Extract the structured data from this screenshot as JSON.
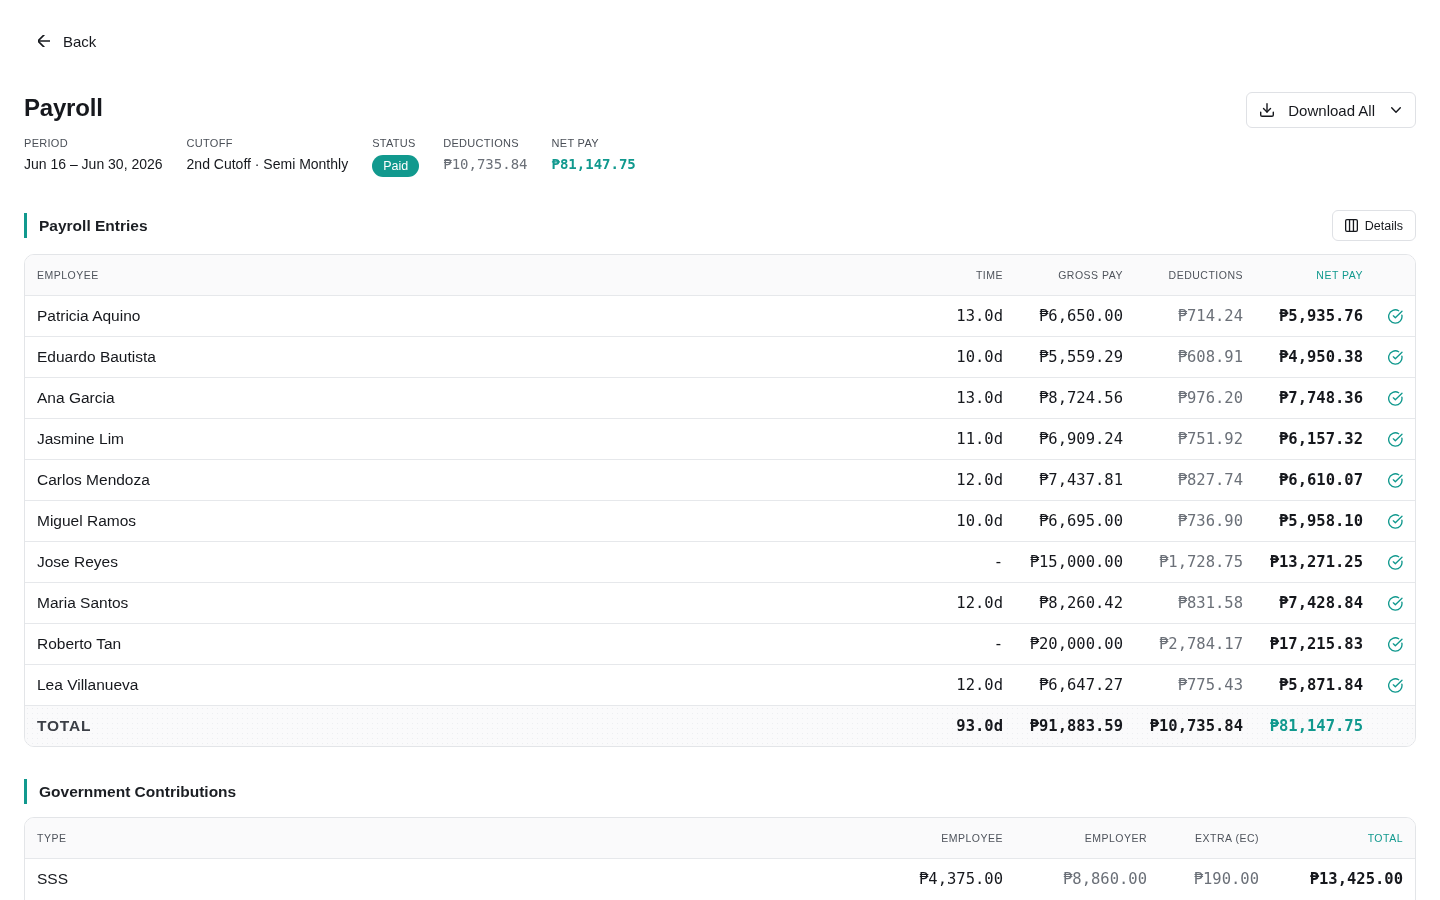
{
  "back_link": {
    "label": "Back"
  },
  "page": {
    "title": "Payroll",
    "download_button": "Download All"
  },
  "summary": [
    {
      "label": "PERIOD",
      "value": "Jun 16 – Jun 30, 2026",
      "kind": "text"
    },
    {
      "label": "CUTOFF",
      "value": "2nd Cutoff · Semi Monthly",
      "kind": "text"
    },
    {
      "label": "STATUS",
      "value": "Paid",
      "kind": "badge"
    },
    {
      "label": "DEDUCTIONS",
      "value": "₱10,735.84",
      "kind": "amount"
    },
    {
      "label": "NET PAY",
      "value": "₱81,147.75",
      "kind": "amount_accent"
    }
  ],
  "entries": {
    "title": "Payroll Entries",
    "details_button": "Details",
    "columns": [
      {
        "label": "EMPLOYEE",
        "highlighted": false
      },
      {
        "label": "TIME",
        "highlighted": false
      },
      {
        "label": "GROSS PAY",
        "highlighted": false
      },
      {
        "label": "DEDUCTIONS",
        "highlighted": false
      },
      {
        "label": "NET PAY",
        "highlighted": true
      }
    ],
    "rows": [
      {
        "employee": "Patricia Aquino",
        "time": "13.0d",
        "gross_pay": "₱6,650.00",
        "deductions": "₱714.24",
        "net_pay": "₱5,935.76",
        "paid": true
      },
      {
        "employee": "Eduardo Bautista",
        "time": "10.0d",
        "gross_pay": "₱5,559.29",
        "deductions": "₱608.91",
        "net_pay": "₱4,950.38",
        "paid": true
      },
      {
        "employee": "Ana Garcia",
        "time": "13.0d",
        "gross_pay": "₱8,724.56",
        "deductions": "₱976.20",
        "net_pay": "₱7,748.36",
        "paid": true
      },
      {
        "employee": "Jasmine Lim",
        "time": "11.0d",
        "gross_pay": "₱6,909.24",
        "deductions": "₱751.92",
        "net_pay": "₱6,157.32",
        "paid": true
      },
      {
        "employee": "Carlos Mendoza",
        "time": "12.0d",
        "gross_pay": "₱7,437.81",
        "deductions": "₱827.74",
        "net_pay": "₱6,610.07",
        "paid": true
      },
      {
        "employee": "Miguel Ramos",
        "time": "10.0d",
        "gross_pay": "₱6,695.00",
        "deductions": "₱736.90",
        "net_pay": "₱5,958.10",
        "paid": true
      },
      {
        "employee": "Jose Reyes",
        "time": "-",
        "gross_pay": "₱15,000.00",
        "deductions": "₱1,728.75",
        "net_pay": "₱13,271.25",
        "paid": true
      },
      {
        "employee": "Maria Santos",
        "time": "12.0d",
        "gross_pay": "₱8,260.42",
        "deductions": "₱831.58",
        "net_pay": "₱7,428.84",
        "paid": true
      },
      {
        "employee": "Roberto Tan",
        "time": "-",
        "gross_pay": "₱20,000.00",
        "deductions": "₱2,784.17",
        "net_pay": "₱17,215.83",
        "paid": true
      },
      {
        "employee": "Lea Villanueva",
        "time": "12.0d",
        "gross_pay": "₱6,647.27",
        "deductions": "₱775.43",
        "net_pay": "₱5,871.84",
        "paid": true
      }
    ],
    "total": {
      "label": "TOTAL",
      "time": "93.0d",
      "gross_pay": "₱91,883.59",
      "deductions": "₱10,735.84",
      "net_pay": "₱81,147.75"
    }
  },
  "contributions": {
    "title": "Government Contributions",
    "columns": [
      {
        "label": "TYPE",
        "highlighted": false
      },
      {
        "label": "EMPLOYEE",
        "highlighted": false
      },
      {
        "label": "EMPLOYER",
        "highlighted": false
      },
      {
        "label": "EXTRA (EC)",
        "highlighted": false
      },
      {
        "label": "TOTAL",
        "highlighted": true
      }
    ],
    "rows": [
      {
        "type": "SSS",
        "employee": "₱4,375.00",
        "employer": "₱8,860.00",
        "extra_ec": "₱190.00",
        "total": "₱13,425.00"
      }
    ]
  }
}
